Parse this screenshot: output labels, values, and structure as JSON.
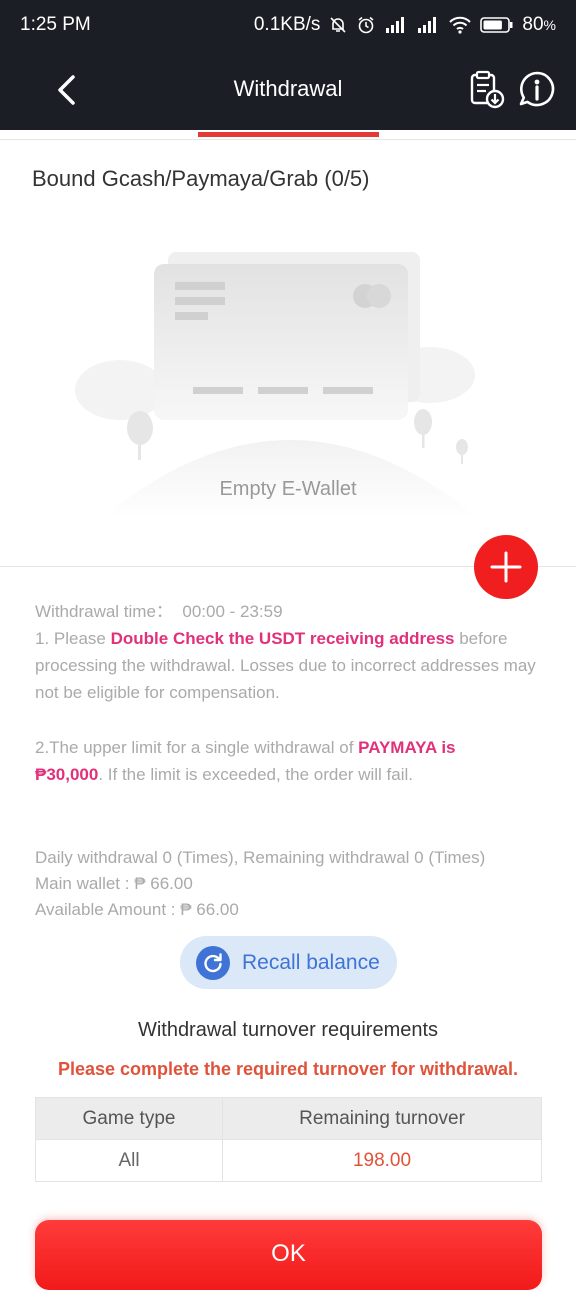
{
  "status_bar": {
    "time": "1:25 PM",
    "network_speed": "0.1KB/s",
    "battery_text": "80",
    "battery_unit": "%",
    "battery_level_percent": 80,
    "icons": [
      "mute-icon",
      "alarm-icon",
      "signal-icon",
      "signal-icon",
      "wifi-icon",
      "battery-icon"
    ]
  },
  "navbar": {
    "title": "Withdrawal",
    "icons": [
      "back-arrow-icon",
      "clipboard-download-icon",
      "info-icon"
    ]
  },
  "ewallet": {
    "section_title": "Bound Gcash/Paymaya/Grab (0/5)",
    "empty_text": "Empty E-Wallet",
    "add_icon": "plus-icon"
  },
  "notes": {
    "time_label": "Withdrawal time：",
    "time_value": "00:00 - 23:59",
    "note1_prefix": "1. Please ",
    "note1_highlight": "Double Check the USDT receiving address",
    "note1_suffix": " before processing the withdrawal. Losses due to incorrect addresses may not be eligible for compensation.",
    "note2_prefix": "2.The upper limit for a single withdrawal of ",
    "note2_highlight1": "PAYMAYA is",
    "note2_highlight2": "₱30,000",
    "note2_suffix": ". If the limit is exceeded, the order will fail."
  },
  "stats": {
    "daily_line": "Daily withdrawal 0 (Times), Remaining withdrawal 0 (Times)",
    "main_wallet": "Main wallet : ₱ 66.00",
    "available": "Available Amount : ₱ 66.00"
  },
  "recall": {
    "label": "Recall balance",
    "icon": "refresh-icon"
  },
  "turnover": {
    "title": "Withdrawal turnover requirements",
    "warning": "Please complete the required turnover for withdrawal.",
    "headers": [
      "Game type",
      "Remaining turnover"
    ],
    "rows": [
      [
        "All",
        "198.00"
      ]
    ]
  },
  "ok_button": "OK",
  "colors": {
    "header_bg": "#1c1e26",
    "accent_red": "#f01e1e",
    "highlight_pink": "#e0317a",
    "link_blue": "#3f73d6",
    "warning_orange": "#e0533a"
  }
}
